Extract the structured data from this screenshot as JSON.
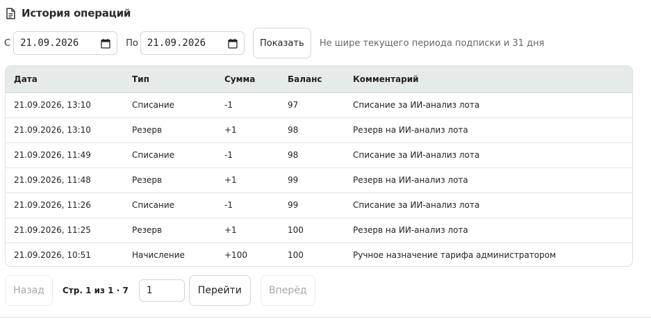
{
  "header": {
    "title": "История операций",
    "icon": "document-icon"
  },
  "filters": {
    "from_label": "С",
    "from_value": "21.09.2026",
    "to_label": "По",
    "to_value": "21.09.2026",
    "show_button": "Показать",
    "hint": "Не шире текущего периода подписки и 31 дня"
  },
  "table": {
    "columns": [
      "Дата",
      "Тип",
      "Сумма",
      "Баланс",
      "Комментарий"
    ],
    "rows": [
      [
        "21.09.2026, 13:10",
        "Списание",
        "-1",
        "97",
        "Списание за ИИ-анализ лота"
      ],
      [
        "21.09.2026, 13:10",
        "Резерв",
        "+1",
        "98",
        "Резерв на ИИ-анализ лота"
      ],
      [
        "21.09.2026, 11:49",
        "Списание",
        "-1",
        "98",
        "Списание за ИИ-анализ лота"
      ],
      [
        "21.09.2026, 11:48",
        "Резерв",
        "+1",
        "99",
        "Резерв на ИИ-анализ лота"
      ],
      [
        "21.09.2026, 11:26",
        "Списание",
        "-1",
        "99",
        "Списание за ИИ-анализ лота"
      ],
      [
        "21.09.2026, 11:25",
        "Резерв",
        "+1",
        "100",
        "Резерв на ИИ-анализ лота"
      ],
      [
        "21.09.2026, 10:51",
        "Начисление",
        "+100",
        "100",
        "Ручное назначение тарифа администратором"
      ]
    ]
  },
  "pagination": {
    "prev_label": "Назад",
    "page_info": "Стр. 1 из 1 · 7",
    "page_input_value": "1",
    "go_label": "Перейти",
    "next_label": "Вперёд"
  },
  "colors": {
    "header_bg": "#e4ebe8",
    "border": "#d9dfdc",
    "disabled_text": "#a7a7a7"
  }
}
